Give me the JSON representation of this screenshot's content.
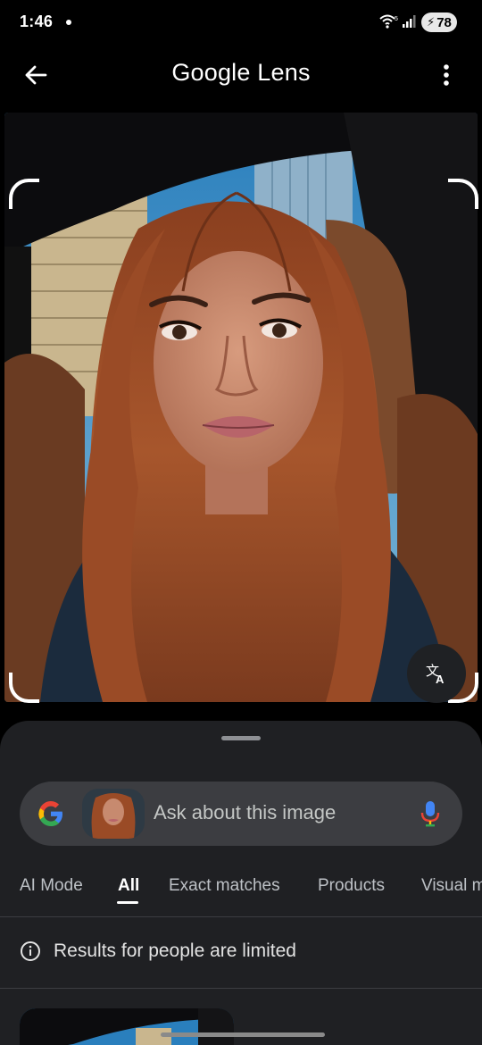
{
  "status_bar": {
    "time": "1:46",
    "network_label": "5",
    "battery": "78"
  },
  "header": {
    "title": "Google Lens",
    "back_icon": "arrow-left-icon",
    "menu_icon": "more-vert-icon"
  },
  "search": {
    "placeholder": "Ask about this image"
  },
  "tabs": [
    {
      "label": "AI Mode",
      "active": false
    },
    {
      "label": "All",
      "active": true
    },
    {
      "label": "Exact matches",
      "active": false
    },
    {
      "label": "Products",
      "active": false
    },
    {
      "label": "Visual m",
      "active": false
    }
  ],
  "notice": {
    "text": "Results for people are limited",
    "icon": "info-icon"
  },
  "colors": {
    "background": "#000000",
    "sheet": "#1f2023",
    "search_bar": "#3c3d41",
    "hair": "#a0522d",
    "sky": "#3b8fc7"
  }
}
